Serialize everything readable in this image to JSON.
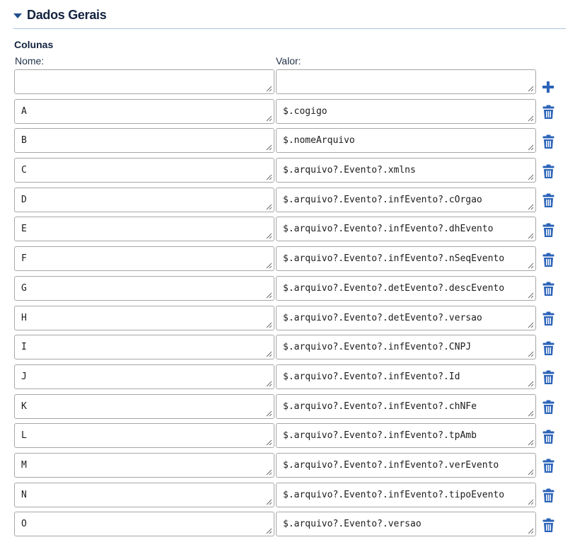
{
  "section": {
    "title": "Dados Gerais"
  },
  "columns": {
    "group_label": "Colunas",
    "nome_label": "Nome:",
    "valor_label": "Valor:"
  },
  "new_row": {
    "nome": "",
    "valor": "",
    "action_icon": "plus-icon"
  },
  "rows": [
    {
      "nome": "A",
      "valor": "$.cogigo"
    },
    {
      "nome": "B",
      "valor": "$.nomeArquivo"
    },
    {
      "nome": "C",
      "valor": "$.arquivo?.Evento?.xmlns"
    },
    {
      "nome": "D",
      "valor": "$.arquivo?.Evento?.infEvento?.cOrgao"
    },
    {
      "nome": "E",
      "valor": "$.arquivo?.Evento?.infEvento?.dhEvento"
    },
    {
      "nome": "F",
      "valor": "$.arquivo?.Evento?.infEvento?.nSeqEvento"
    },
    {
      "nome": "G",
      "valor": "$.arquivo?.Evento?.detEvento?.descEvento"
    },
    {
      "nome": "H",
      "valor": "$.arquivo?.Evento?.detEvento?.versao"
    },
    {
      "nome": "I",
      "valor": "$.arquivo?.Evento?.infEvento?.CNPJ"
    },
    {
      "nome": "J",
      "valor": "$.arquivo?.Evento?.infEvento?.Id"
    },
    {
      "nome": "K",
      "valor": "$.arquivo?.Evento?.infEvento?.chNFe"
    },
    {
      "nome": "L",
      "valor": "$.arquivo?.Evento?.infEvento?.tpAmb"
    },
    {
      "nome": "M",
      "valor": "$.arquivo?.Evento?.infEvento?.verEvento"
    },
    {
      "nome": "N",
      "valor": "$.arquivo?.Evento?.infEvento?.tipoEvento"
    },
    {
      "nome": "O",
      "valor": "$.arquivo?.Evento?.versao"
    }
  ],
  "row_action_icon": "trash-icon",
  "colors": {
    "accent": "#2b63b8",
    "title": "#13233f",
    "divider": "#a9c3dd"
  }
}
